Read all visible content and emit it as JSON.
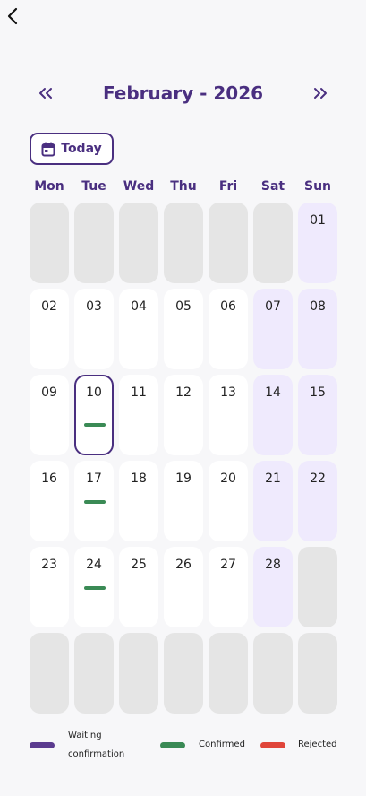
{
  "header": {
    "month_title": "February - 2026",
    "prev_icon": "chevrons-left-icon",
    "next_icon": "chevrons-right-icon",
    "back_icon": "chevron-left-icon"
  },
  "today_button": {
    "label": "Today",
    "icon": "calendar-icon"
  },
  "weekdays": [
    "Mon",
    "Tue",
    "Wed",
    "Thu",
    "Fri",
    "Sat",
    "Sun"
  ],
  "weeks": [
    [
      {
        "day": "",
        "type": "empty"
      },
      {
        "day": "",
        "type": "empty"
      },
      {
        "day": "",
        "type": "empty"
      },
      {
        "day": "",
        "type": "empty"
      },
      {
        "day": "",
        "type": "empty"
      },
      {
        "day": "",
        "type": "empty"
      },
      {
        "day": "01",
        "type": "weekend"
      }
    ],
    [
      {
        "day": "02",
        "type": "weekday"
      },
      {
        "day": "03",
        "type": "weekday"
      },
      {
        "day": "04",
        "type": "weekday"
      },
      {
        "day": "05",
        "type": "weekday"
      },
      {
        "day": "06",
        "type": "weekday"
      },
      {
        "day": "07",
        "type": "weekend"
      },
      {
        "day": "08",
        "type": "weekend"
      }
    ],
    [
      {
        "day": "09",
        "type": "weekday"
      },
      {
        "day": "10",
        "type": "weekday",
        "today": true,
        "event": "confirmed"
      },
      {
        "day": "11",
        "type": "weekday"
      },
      {
        "day": "12",
        "type": "weekday"
      },
      {
        "day": "13",
        "type": "weekday"
      },
      {
        "day": "14",
        "type": "weekend"
      },
      {
        "day": "15",
        "type": "weekend"
      }
    ],
    [
      {
        "day": "16",
        "type": "weekday"
      },
      {
        "day": "17",
        "type": "weekday",
        "event": "confirmed"
      },
      {
        "day": "18",
        "type": "weekday"
      },
      {
        "day": "19",
        "type": "weekday"
      },
      {
        "day": "20",
        "type": "weekday"
      },
      {
        "day": "21",
        "type": "weekend"
      },
      {
        "day": "22",
        "type": "weekend"
      }
    ],
    [
      {
        "day": "23",
        "type": "weekday"
      },
      {
        "day": "24",
        "type": "weekday",
        "event": "confirmed"
      },
      {
        "day": "25",
        "type": "weekday"
      },
      {
        "day": "26",
        "type": "weekday"
      },
      {
        "day": "27",
        "type": "weekday"
      },
      {
        "day": "28",
        "type": "weekend"
      },
      {
        "day": "",
        "type": "empty"
      }
    ],
    [
      {
        "day": "",
        "type": "empty"
      },
      {
        "day": "",
        "type": "empty"
      },
      {
        "day": "",
        "type": "empty"
      },
      {
        "day": "",
        "type": "empty"
      },
      {
        "day": "",
        "type": "empty"
      },
      {
        "day": "",
        "type": "empty"
      },
      {
        "day": "",
        "type": "empty"
      }
    ]
  ],
  "legend": {
    "waiting_line1": "Waiting",
    "waiting_line2": "confirmation",
    "confirmed": "Confirmed",
    "rejected": "Rejected"
  },
  "colors": {
    "primary": "#4a2f80",
    "waiting": "#5b3b8f",
    "confirmed": "#3a8a55",
    "rejected": "#e0453a",
    "weekend_bg": "#efeafd",
    "empty_bg": "#e5e5e5",
    "page_bg": "#f7f7f9"
  }
}
